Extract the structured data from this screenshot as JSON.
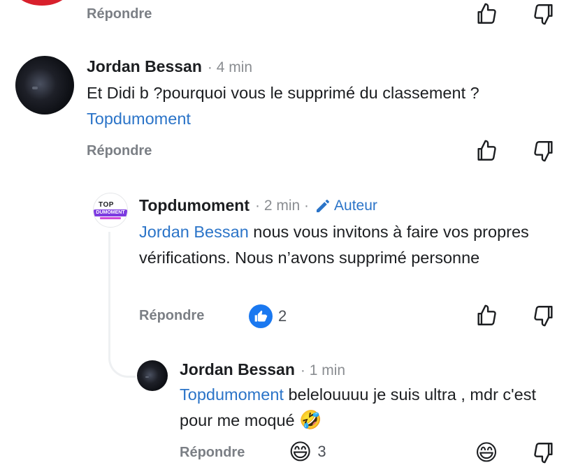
{
  "reply_label": "Répondre",
  "comments": [
    {
      "name": "Jordan Bessan",
      "time": "· 4 min",
      "text": "Et Didi b ?pourquoi vous le supprimé du classement ?",
      "mention": "Topdumoment"
    },
    {
      "name": "Topdumoment",
      "time": "· 2 min ·",
      "author_badge": "Auteur",
      "mention": "Jordan Bessan",
      "text": " nous vous invitons à faire vos propres vérifications. Nous n’avons supprimé personne",
      "reaction": {
        "icon": "like-badge-icon",
        "count": "2"
      }
    },
    {
      "name": "Jordan Bessan",
      "time": "· 1 min",
      "mention": "Topdumoment",
      "text": " belelouuuu je suis ultra , mdr c'est pour me moqué",
      "emoji": "🤣",
      "reaction": {
        "icon": "laughing-emoji-icon",
        "emoji": "😄",
        "count": "3"
      },
      "like_emoji": "😄"
    }
  ],
  "logo": {
    "top": "TOP",
    "bar": "DUMOMENT"
  },
  "colors": {
    "mention": "#2b74c8",
    "muted": "#8a8d91",
    "like_badge": "#1a78f0"
  }
}
